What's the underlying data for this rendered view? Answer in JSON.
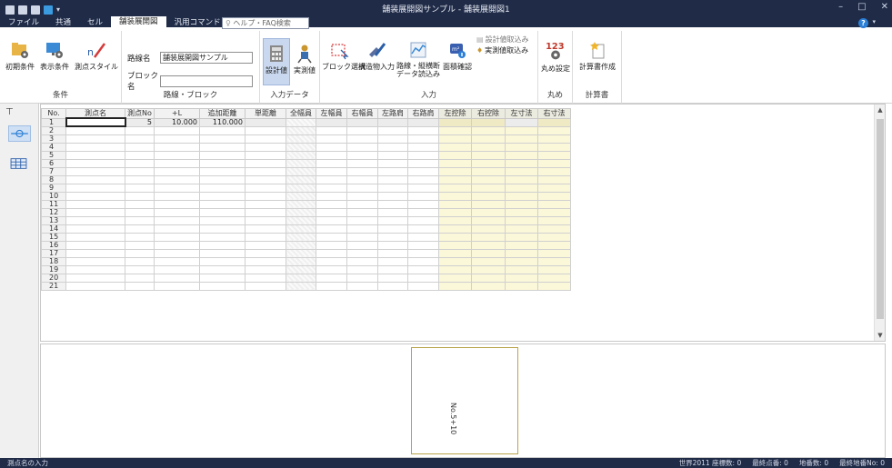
{
  "window": {
    "title": "舗装展開図サンプル - 舗装展開図1"
  },
  "tabs": [
    {
      "label": "ファイル"
    },
    {
      "label": "共通"
    },
    {
      "label": "セル"
    },
    {
      "label": "舗装展開図",
      "active": true
    },
    {
      "label": "汎用コマンド"
    }
  ],
  "help_search": {
    "placeholder": "ヘルプ・FAQ検索"
  },
  "ribbon": {
    "jouken": {
      "label": "条件",
      "buttons": [
        "初期条件",
        "表示条件",
        "測点スタイル"
      ]
    },
    "rosen_block": {
      "label": "路線・ブロック",
      "route_name_label": "路線名",
      "route_name_value": "舗装展開図サンプル",
      "block_name_label": "ブロック名",
      "block_name_value": ""
    },
    "input_data": {
      "label": "入力データ",
      "buttons": [
        "設計値",
        "実測値"
      ]
    },
    "input": {
      "label": "入力",
      "buttons": [
        "ブロック選択",
        "構造物入力",
        "路線・縦横断\nデータ読込み",
        "面積確認"
      ],
      "small": [
        "設計値取込み",
        "実測値取込み"
      ]
    },
    "marume": {
      "label": "丸め",
      "buttons": [
        "丸め設定"
      ]
    },
    "keisan": {
      "label": "計算書",
      "buttons": [
        "計算書作成"
      ]
    }
  },
  "grid": {
    "columns": [
      "No.",
      "測点名",
      "測点No",
      "+L",
      "追加距離",
      "単距離",
      "全幅員",
      "左幅員",
      "右幅員",
      "左路肩",
      "右路肩",
      "左控除",
      "右控除",
      "左寸法",
      "右寸法"
    ],
    "rows": [
      [
        "1",
        "",
        "5",
        "10.000",
        "110.000",
        "",
        "",
        "",
        "",
        "",
        "",
        "",
        "",
        "",
        ""
      ],
      [
        "2"
      ],
      [
        "3"
      ],
      [
        "4"
      ],
      [
        "5"
      ],
      [
        "6"
      ],
      [
        "7"
      ],
      [
        "8"
      ],
      [
        "9"
      ],
      [
        "10"
      ],
      [
        "11"
      ],
      [
        "12"
      ],
      [
        "13"
      ],
      [
        "14"
      ],
      [
        "15"
      ],
      [
        "16"
      ],
      [
        "17"
      ],
      [
        "18"
      ],
      [
        "19"
      ],
      [
        "20"
      ],
      [
        "21"
      ]
    ]
  },
  "drawing": {
    "station_label": "No.5+10"
  },
  "status": {
    "left": "測点名の入力",
    "items": [
      "世界2011 座標数:  0",
      "最終点番:  0",
      "地番数:  0",
      "最終地番No:  0"
    ]
  },
  "colors": {
    "titlebar": "#1f2b47",
    "accent_yellow": "#fbf7d9",
    "sheet_border": "#b8a348"
  }
}
